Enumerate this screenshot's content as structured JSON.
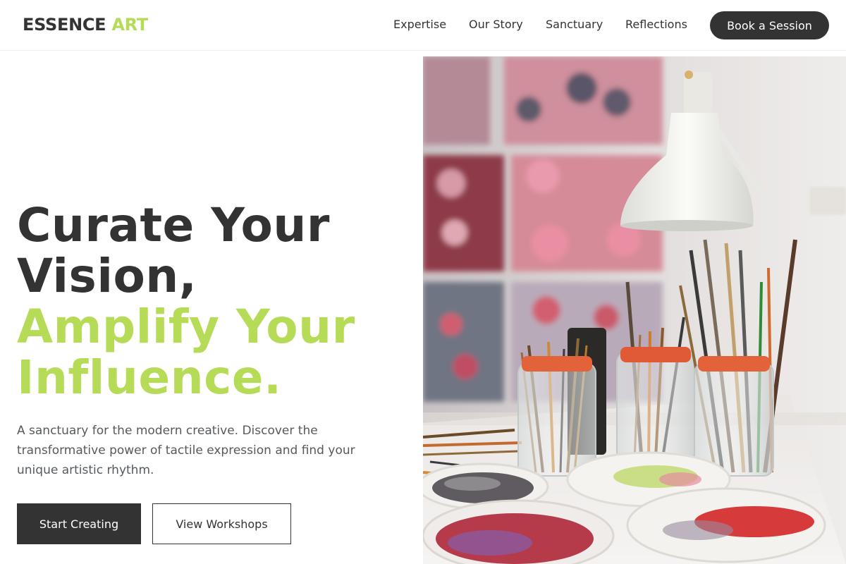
{
  "brand": {
    "name_part1": "ESSENCE",
    "name_part2": "ART",
    "accent_color": "#b6db57"
  },
  "nav": {
    "links": [
      "Expertise",
      "Our Story",
      "Sanctuary",
      "Reflections"
    ],
    "cta_label": "Book a Session"
  },
  "hero": {
    "headline_line1": "Curate Your",
    "headline_line2": "Vision,",
    "headline_line3": "Amplify Your",
    "headline_line4": "Influence.",
    "description": "A sanctuary for the modern creative. Discover the transformative power of tactile expression and find your unique artistic rhythm.",
    "primary_button": "Start Creating",
    "secondary_button": "View Workshops"
  },
  "colors": {
    "dark": "#333333",
    "text_muted": "#555a5e",
    "border": "#ececec"
  }
}
